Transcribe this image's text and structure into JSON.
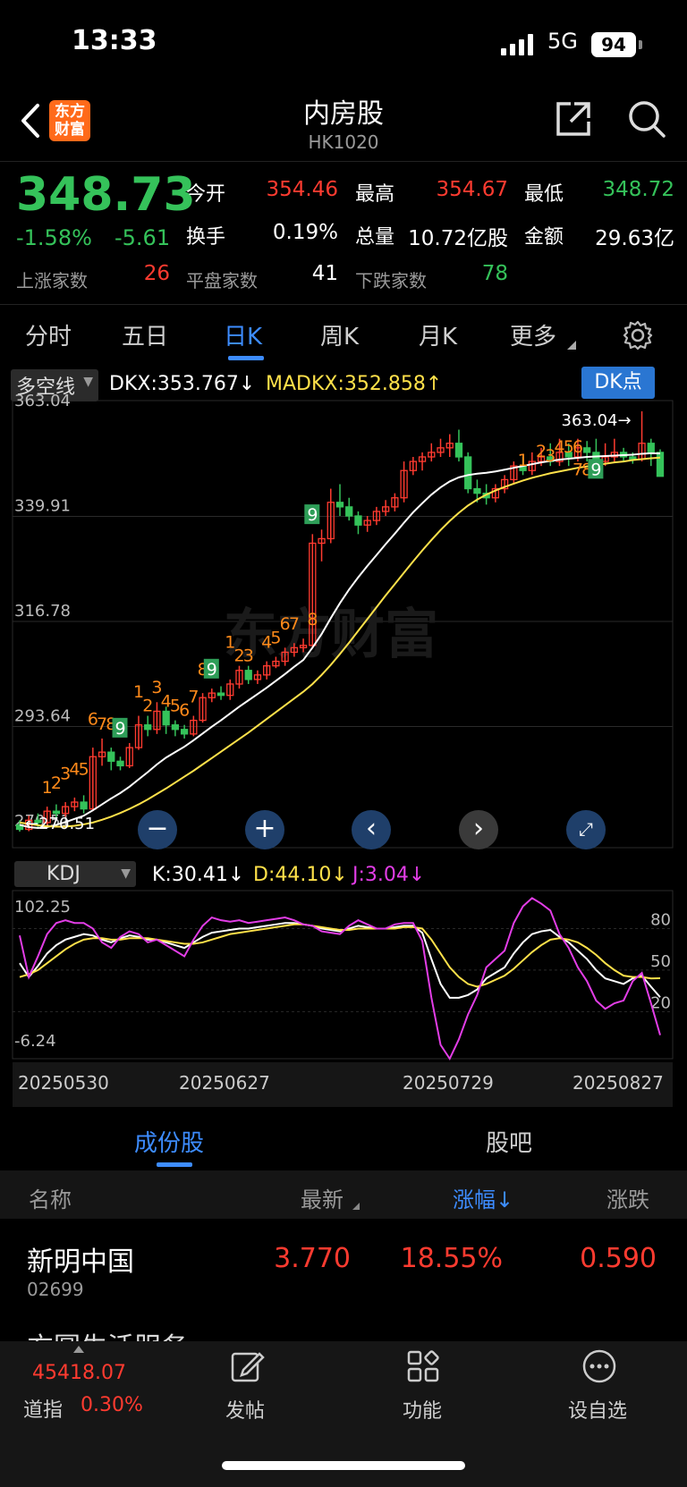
{
  "status_bar": {
    "time": "13:33",
    "network": "5G",
    "battery": "94"
  },
  "header": {
    "title": "内房股",
    "code": "HK1020",
    "logo_text": "东方财富"
  },
  "quote": {
    "price": "348.73",
    "change_pct": "-1.58%",
    "change": "-5.61",
    "open_label": "今开",
    "open": "354.46",
    "high_label": "最高",
    "high": "354.67",
    "low_label": "最低",
    "low": "348.72",
    "turnover_label": "换手",
    "turnover": "0.19%",
    "volume_label": "总量",
    "volume": "10.72亿股",
    "amount_label": "金额",
    "amount": "29.63亿",
    "up_label": "上涨家数",
    "up": "26",
    "flat_label": "平盘家数",
    "flat": "41",
    "down_label": "下跌家数",
    "down": "78"
  },
  "period_tabs": [
    "分时",
    "五日",
    "日K",
    "周K",
    "月K",
    "更多"
  ],
  "indicator": {
    "name": "多空线",
    "dkx": "DKX:353.767↓",
    "madkx": "MADKX:352.858↑",
    "dk_button": "DK点"
  },
  "kdj": {
    "name": "KDJ",
    "k": "K:30.41↓",
    "d": "D:44.10↓",
    "j": "J:3.04↓"
  },
  "colors": {
    "up": "#ff3b30",
    "down": "#35c25a",
    "accent": "#3d8cff",
    "white_line": "#ffffff",
    "yellow_line": "#ffe14a",
    "magenta_line": "#e23de6",
    "orange_label": "#ff8a1a"
  },
  "chart_data": [
    {
      "type": "candlestick",
      "y_ticks": [
        "363.04",
        "339.91",
        "316.78",
        "293.64",
        "270.51"
      ],
      "ylim": [
        270.51,
        363.04
      ],
      "x_ticks": [
        "20250530",
        "20250627",
        "20250729",
        "20250827"
      ],
      "annotations": {
        "max_label": "363.04→",
        "min_label": "←270.51"
      },
      "trend_counts": [
        {
          "text": "1",
          "index": 3,
          "price": 279
        },
        {
          "text": "2",
          "index": 4,
          "price": 280
        },
        {
          "text": "3",
          "index": 5,
          "price": 282
        },
        {
          "text": "4",
          "index": 6,
          "price": 283
        },
        {
          "text": "5",
          "index": 7,
          "price": 283
        },
        {
          "text": "6",
          "index": 8,
          "price": 294
        },
        {
          "text": "7",
          "index": 9,
          "price": 293
        },
        {
          "text": "8",
          "index": 10,
          "price": 293
        },
        {
          "text": "9",
          "index": 11,
          "price": 292,
          "green": true
        },
        {
          "text": "1",
          "index": 13,
          "price": 300
        },
        {
          "text": "2",
          "index": 14,
          "price": 297
        },
        {
          "text": "3",
          "index": 15,
          "price": 301
        },
        {
          "text": "4",
          "index": 16,
          "price": 298
        },
        {
          "text": "5",
          "index": 17,
          "price": 297
        },
        {
          "text": "6",
          "index": 18,
          "price": 296
        },
        {
          "text": "7",
          "index": 19,
          "price": 299
        },
        {
          "text": "8",
          "index": 20,
          "price": 305
        },
        {
          "text": "9",
          "index": 21,
          "price": 305,
          "green": true
        },
        {
          "text": "1",
          "index": 23,
          "price": 311
        },
        {
          "text": "2",
          "index": 24,
          "price": 308
        },
        {
          "text": "3",
          "index": 25,
          "price": 308
        },
        {
          "text": "4",
          "index": 27,
          "price": 311
        },
        {
          "text": "5",
          "index": 28,
          "price": 312
        },
        {
          "text": "6",
          "index": 29,
          "price": 315
        },
        {
          "text": "7",
          "index": 30,
          "price": 315
        },
        {
          "text": "8",
          "index": 32,
          "price": 316
        },
        {
          "text": "9",
          "index": 32,
          "price": 339,
          "green": true
        },
        {
          "text": "1",
          "index": 55,
          "price": 351
        },
        {
          "text": "2",
          "index": 57,
          "price": 353
        },
        {
          "text": "3",
          "index": 58,
          "price": 352
        },
        {
          "text": "4",
          "index": 59,
          "price": 354
        },
        {
          "text": "5",
          "index": 60,
          "price": 354
        },
        {
          "text": "6",
          "index": 61,
          "price": 354
        },
        {
          "text": "7",
          "index": 61,
          "price": 349
        },
        {
          "text": "8",
          "index": 62,
          "price": 349
        },
        {
          "text": "9",
          "index": 63,
          "price": 349,
          "green": true
        }
      ],
      "candles": [
        {
          "o": 272,
          "c": 271,
          "h": 273,
          "l": 270.5
        },
        {
          "o": 271,
          "c": 273,
          "h": 274,
          "l": 270.6
        },
        {
          "o": 273,
          "c": 272.5,
          "h": 274.5,
          "l": 271.5
        },
        {
          "o": 272.5,
          "c": 275,
          "h": 276,
          "l": 272
        },
        {
          "o": 275,
          "c": 274.5,
          "h": 276.5,
          "l": 273.5
        },
        {
          "o": 274.5,
          "c": 276,
          "h": 277,
          "l": 273.8
        },
        {
          "o": 276,
          "c": 277,
          "h": 278,
          "l": 275
        },
        {
          "o": 277,
          "c": 275.5,
          "h": 278.5,
          "l": 274.5
        },
        {
          "o": 275.5,
          "c": 287,
          "h": 289,
          "l": 275
        },
        {
          "o": 287,
          "c": 288,
          "h": 291,
          "l": 285
        },
        {
          "o": 288,
          "c": 286,
          "h": 289,
          "l": 284
        },
        {
          "o": 286,
          "c": 285,
          "h": 287,
          "l": 284
        },
        {
          "o": 285,
          "c": 289,
          "h": 290,
          "l": 284.5
        },
        {
          "o": 289,
          "c": 294,
          "h": 296,
          "l": 288.5
        },
        {
          "o": 294,
          "c": 293,
          "h": 296,
          "l": 291.5
        },
        {
          "o": 293,
          "c": 297,
          "h": 299,
          "l": 292
        },
        {
          "o": 297,
          "c": 294,
          "h": 298,
          "l": 292
        },
        {
          "o": 294,
          "c": 293,
          "h": 295,
          "l": 291.5
        },
        {
          "o": 293,
          "c": 292,
          "h": 294,
          "l": 291
        },
        {
          "o": 292,
          "c": 295,
          "h": 296,
          "l": 291.5
        },
        {
          "o": 295,
          "c": 300,
          "h": 301,
          "l": 294.5
        },
        {
          "o": 300,
          "c": 301,
          "h": 302,
          "l": 299
        },
        {
          "o": 301,
          "c": 300.5,
          "h": 302.5,
          "l": 299.5
        },
        {
          "o": 300.5,
          "c": 303,
          "h": 304,
          "l": 299.5
        },
        {
          "o": 303,
          "c": 306,
          "h": 307,
          "l": 302
        },
        {
          "o": 306,
          "c": 304,
          "h": 307,
          "l": 303
        },
        {
          "o": 304,
          "c": 305,
          "h": 306,
          "l": 303
        },
        {
          "o": 305,
          "c": 307,
          "h": 308,
          "l": 304
        },
        {
          "o": 307,
          "c": 308,
          "h": 309,
          "l": 306.5
        },
        {
          "o": 308,
          "c": 310,
          "h": 311,
          "l": 307
        },
        {
          "o": 310,
          "c": 311,
          "h": 312,
          "l": 309
        },
        {
          "o": 311,
          "c": 311.5,
          "h": 313,
          "l": 310
        },
        {
          "o": 311.5,
          "c": 334,
          "h": 336,
          "l": 311
        },
        {
          "o": 334,
          "c": 335,
          "h": 337,
          "l": 330
        },
        {
          "o": 335,
          "c": 343,
          "h": 346,
          "l": 334
        },
        {
          "o": 343,
          "c": 342,
          "h": 347,
          "l": 340
        },
        {
          "o": 342,
          "c": 340,
          "h": 344,
          "l": 339
        },
        {
          "o": 340,
          "c": 338,
          "h": 341,
          "l": 336
        },
        {
          "o": 338,
          "c": 339,
          "h": 340,
          "l": 336.5
        },
        {
          "o": 339,
          "c": 341,
          "h": 342,
          "l": 338
        },
        {
          "o": 341,
          "c": 342,
          "h": 343.5,
          "l": 340
        },
        {
          "o": 342,
          "c": 344,
          "h": 345,
          "l": 341
        },
        {
          "o": 344,
          "c": 350,
          "h": 352,
          "l": 343
        },
        {
          "o": 350,
          "c": 352,
          "h": 353,
          "l": 349
        },
        {
          "o": 352,
          "c": 353,
          "h": 354,
          "l": 350
        },
        {
          "o": 353,
          "c": 354,
          "h": 356,
          "l": 352
        },
        {
          "o": 354,
          "c": 355,
          "h": 357,
          "l": 353
        },
        {
          "o": 355,
          "c": 356,
          "h": 358,
          "l": 353
        },
        {
          "o": 356,
          "c": 353,
          "h": 359,
          "l": 352
        },
        {
          "o": 353,
          "c": 346,
          "h": 354,
          "l": 345
        },
        {
          "o": 346,
          "c": 345,
          "h": 348,
          "l": 343
        },
        {
          "o": 345,
          "c": 344,
          "h": 347,
          "l": 342.5
        },
        {
          "o": 344,
          "c": 346,
          "h": 347,
          "l": 343
        },
        {
          "o": 346,
          "c": 348,
          "h": 349,
          "l": 345
        },
        {
          "o": 348,
          "c": 351,
          "h": 352,
          "l": 347
        },
        {
          "o": 351,
          "c": 350,
          "h": 353,
          "l": 349
        },
        {
          "o": 350,
          "c": 352,
          "h": 354,
          "l": 349
        },
        {
          "o": 352,
          "c": 353,
          "h": 355,
          "l": 351
        },
        {
          "o": 353,
          "c": 352,
          "h": 356,
          "l": 351
        },
        {
          "o": 352,
          "c": 354,
          "h": 357,
          "l": 351
        },
        {
          "o": 354,
          "c": 353,
          "h": 356,
          "l": 351
        },
        {
          "o": 353,
          "c": 355,
          "h": 357,
          "l": 352
        },
        {
          "o": 355,
          "c": 354,
          "h": 356.5,
          "l": 352
        },
        {
          "o": 354,
          "c": 352,
          "h": 357,
          "l": 351
        },
        {
          "o": 352,
          "c": 353,
          "h": 356,
          "l": 351
        },
        {
          "o": 353,
          "c": 354,
          "h": 357,
          "l": 352
        },
        {
          "o": 354,
          "c": 353,
          "h": 355,
          "l": 352
        },
        {
          "o": 353,
          "c": 352.5,
          "h": 354,
          "l": 351.5
        },
        {
          "o": 352.5,
          "c": 356,
          "h": 363.04,
          "l": 352
        },
        {
          "o": 356,
          "c": 354,
          "h": 357,
          "l": 351
        },
        {
          "o": 354,
          "c": 348.73,
          "h": 354.67,
          "l": 348.72
        }
      ],
      "series": [
        {
          "name": "DKX",
          "values": [
            272,
            271.5,
            271.3,
            271.5,
            272,
            272.6,
            273.3,
            274,
            275.2,
            276.5,
            277.8,
            279,
            280.4,
            282,
            283.6,
            285.3,
            286.8,
            288,
            289.2,
            290.6,
            292.1,
            293.6,
            295,
            296.5,
            298,
            299.4,
            300.8,
            302.2,
            303.7,
            305.2,
            306.8,
            308.3,
            311,
            314,
            317.5,
            320.8,
            323.8,
            326.5,
            329,
            331.4,
            333.8,
            336.1,
            338.5,
            340.8,
            342.8,
            344.7,
            346.3,
            347.6,
            348.5,
            349,
            349.3,
            349.5,
            349.8,
            350.2,
            350.6,
            351,
            351.4,
            351.8,
            352.1,
            352.4,
            352.6,
            352.8,
            353,
            353.1,
            353.2,
            353.3,
            353.4,
            353.5,
            353.7,
            353.8,
            353.767
          ]
        },
        {
          "name": "MADKX",
          "values": [
            272.5,
            272.2,
            271.9,
            271.7,
            271.6,
            271.6,
            271.8,
            272.1,
            272.5,
            273.1,
            273.8,
            274.6,
            275.5,
            276.5,
            277.6,
            278.8,
            280,
            281.3,
            282.6,
            283.9,
            285.3,
            286.7,
            288.1,
            289.5,
            290.9,
            292.3,
            293.8,
            295.3,
            296.8,
            298.3,
            299.8,
            301.3,
            303,
            305,
            307.2,
            309.6,
            312.1,
            314.7,
            317.3,
            319.9,
            322.5,
            325,
            327.5,
            330,
            332.4,
            334.7,
            336.9,
            338.9,
            340.7,
            342.3,
            343.6,
            344.7,
            345.6,
            346.4,
            347.1,
            347.8,
            348.4,
            348.9,
            349.4,
            349.8,
            350.2,
            350.6,
            350.9,
            351.2,
            351.5,
            351.8,
            352,
            352.3,
            352.5,
            352.7,
            352.858
          ]
        }
      ]
    },
    {
      "type": "line",
      "y_ticks": [
        "102.25",
        "-6.24"
      ],
      "ylim": [
        -6.24,
        102.25
      ],
      "right_labels": [
        "80",
        "50",
        "20"
      ],
      "series": [
        {
          "name": "K",
          "values": [
            55,
            45,
            53,
            62,
            68,
            72,
            74,
            76,
            75,
            72,
            70,
            73,
            75,
            74,
            72,
            72,
            70,
            68,
            66,
            70,
            74,
            77,
            78,
            79,
            80,
            80,
            81,
            82,
            83,
            84,
            84,
            83,
            82,
            80,
            79,
            78,
            80,
            82,
            81,
            80,
            80,
            81,
            82,
            82,
            77,
            58,
            40,
            30,
            30,
            32,
            36,
            44,
            48,
            52,
            62,
            70,
            76,
            78,
            79,
            74,
            70,
            64,
            58,
            50,
            44,
            42,
            40,
            44,
            46,
            38,
            30.41
          ]
        },
        {
          "name": "D",
          "values": [
            45,
            47,
            50,
            55,
            60,
            65,
            69,
            72,
            73,
            73,
            72,
            72,
            73,
            73,
            73,
            72,
            71,
            70,
            69,
            69,
            70,
            72,
            74,
            76,
            77,
            78,
            79,
            80,
            81,
            82,
            83,
            83,
            82,
            81,
            80,
            79,
            79,
            80,
            80,
            80,
            80,
            80,
            81,
            81,
            80,
            72,
            62,
            52,
            45,
            40,
            38,
            40,
            43,
            46,
            51,
            57,
            63,
            68,
            72,
            73,
            72,
            70,
            66,
            61,
            55,
            50,
            46,
            45,
            45,
            44,
            44.1
          ]
        },
        {
          "name": "J",
          "values": [
            75,
            45,
            60,
            76,
            84,
            86,
            84,
            84,
            80,
            70,
            66,
            74,
            78,
            76,
            70,
            72,
            68,
            64,
            60,
            72,
            82,
            88,
            86,
            85,
            86,
            84,
            85,
            86,
            87,
            88,
            86,
            83,
            82,
            78,
            77,
            76,
            82,
            86,
            83,
            80,
            80,
            83,
            84,
            84,
            71,
            30,
            -4,
            -14,
            0,
            18,
            32,
            52,
            58,
            64,
            84,
            96,
            102,
            98,
            93,
            76,
            66,
            52,
            42,
            28,
            22,
            26,
            28,
            42,
            48,
            26,
            3.04
          ]
        }
      ]
    }
  ],
  "chart_controls": [
    "zoom-out",
    "zoom-in",
    "prev",
    "next",
    "fullscreen"
  ],
  "sub_tabs": [
    "成份股",
    "股吧"
  ],
  "table": {
    "headers": [
      "名称",
      "最新",
      "涨幅↓",
      "涨跌"
    ],
    "rows": [
      {
        "name": "新明中国",
        "code": "02699",
        "price": "3.770",
        "pct": "18.55%",
        "change": "0.590"
      }
    ],
    "partial_row": {
      "name": "方圆生活服务"
    }
  },
  "bottom_bar": {
    "index_value": "45418.07",
    "index_name": "道指",
    "index_pct": "0.30%",
    "items": [
      "发帖",
      "功能",
      "设自选"
    ]
  }
}
